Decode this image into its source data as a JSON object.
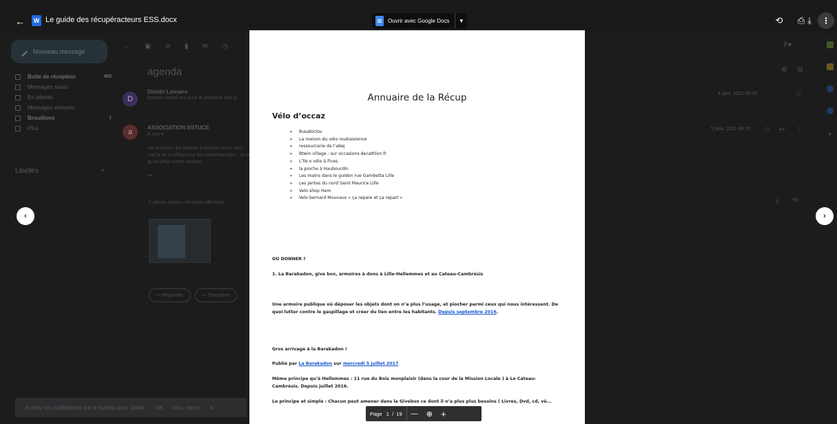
{
  "viewer": {
    "doc_title": "Le guide des récupéracteurs ESS.docx",
    "word_letter": "W",
    "open_with_label": "Ouvrir avec Google Docs",
    "back_icon": "←",
    "add_drive_icon": "⟲",
    "print_icon": "⎙",
    "download_icon": "⤓",
    "more_icon": "⋮",
    "prev_icon": "‹",
    "next_icon": "›"
  },
  "gmail": {
    "compose_label": "Nouveau message",
    "nav": [
      {
        "label": "Boîte de réception",
        "count": "405",
        "bold": true
      },
      {
        "label": "Messages suivis",
        "count": "",
        "bold": false
      },
      {
        "label": "En attente",
        "count": "",
        "bold": false
      },
      {
        "label": "Messages envoyés",
        "count": "",
        "bold": false
      },
      {
        "label": "Brouillons",
        "count": "1",
        "bold": true
      },
      {
        "label": "Plus",
        "count": "",
        "bold": false
      }
    ],
    "labels_title": "Libellés",
    "labels_add": "+",
    "subject": "agenda",
    "msg1": {
      "avatar": "D",
      "from": "Dimitri Lemaire",
      "snippet": "bonsoir Isabel ces pour te présenté que je",
      "date": "4 janv. 2021 00:35"
    },
    "msg2": {
      "avatar": "a",
      "from": "ASSOCIATION ASTUCE",
      "to": "À moi ▾",
      "body": "sur la photo, les bennes à Auchan leers sont... mal si on a ailleurs sur les supermarchés... et ce qu'on peut mettre dedans",
      "more": "•••",
      "date": "5 janv. 2021 08:26"
    },
    "attachments": "5 pièces jointes • Analyse effectuée",
    "reply": "Répondre",
    "forward": "Transférer",
    "notif_text": "Activez les notifications sur le bureau pour Gmail.",
    "notif_ok": "OK",
    "notif_no": "Non, merci",
    "notif_close": "✕"
  },
  "document": {
    "title": "Annuaire de la Récup",
    "section": "Vélo d’occaz",
    "bullets": [
      "Busabiclou",
      "La maison du vélo roubaisienne",
      "ressourcerie de l’abej",
      "Btwin village : sur occasions.decathlon.fr",
      "L’île o vélo à Fives",
      "la pioche à Haubourdin",
      "Les mains dans le guidon rue Gambetta Lille",
      "Les jantes du nord Saint Maurice  Lille",
      "Velo shop  Hem",
      "Velo bernard  Mouvaux « ça repare et ça repart »"
    ],
    "ou_donner": "OU DONNER ?",
    "barakadon_heading": "1. La Barakadon, give box, armoires à dons à Lille-Hellemmes et au Cateau-Cambrésis",
    "armoire_text": "Une armoire publique où déposer les objets dont on n’a plus l’usage, et piocher parmi ceux qui nous intéressent. De quoi lutter contre le gaspillage et créer du lien entre les habitants.",
    "armoire_link": "Depuis septembre 2016",
    "armoire_end": ".",
    "arrivage": "Gros arrivage à la Barakadon !",
    "publie_prefix": "Publié par",
    "publie_author": "La Barakadon",
    "publie_mid": "sur",
    "publie_date": "mercredi 5 juillet 2017",
    "principe": "Même principe qu’à Hellemmes : 11 rue du Bois monplaisir (dans la cour de la Mission Locale ) à Le Cateau-Cambrésis. Depuis juillet 2016.",
    "simple": "Le principe et simple : Chacun peut amener dans la Givebox ce dont il n’a plus plus besoins ( Livres, Dvd, cd, vê..."
  },
  "pager": {
    "label": "Page",
    "current": "1",
    "slash": "/",
    "total": "19",
    "zoom_out": "—",
    "zoom_icon": "⊕",
    "zoom_in": "+"
  }
}
